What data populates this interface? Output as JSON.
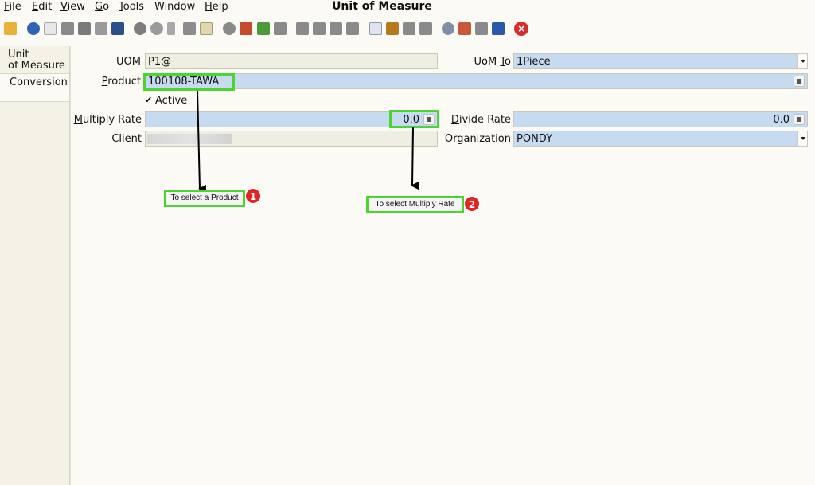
{
  "window_title": "Unit of Measure",
  "menu": [
    {
      "mnemonic": "F",
      "rest": "ile"
    },
    {
      "mnemonic": "E",
      "rest": "dit"
    },
    {
      "mnemonic": "V",
      "rest": "iew"
    },
    {
      "mnemonic": "G",
      "rest": "o"
    },
    {
      "mnemonic": "T",
      "rest": "ools"
    },
    {
      "mnemonic": "",
      "rest": "Window"
    },
    {
      "mnemonic": "H",
      "rest": "elp"
    }
  ],
  "toolbar_icons": [
    "undo-icon",
    "help-icon",
    "new-record-icon",
    "copy-record-icon",
    "delete-icon",
    "delete-selection-icon",
    "save-icon",
    "refresh-icon",
    "find-icon",
    "attachment-icon",
    "chat-icon",
    "grid-toggle-icon",
    "history-icon",
    "home-icon",
    "back-icon",
    "forward-icon",
    "first-record-icon",
    "previous-record-icon",
    "next-record-icon",
    "last-record-icon",
    "report-icon",
    "archive-icon",
    "print-preview-icon",
    "print-icon",
    "zoom-across-icon",
    "workflow-icon",
    "request-icon",
    "product-info-icon",
    "close-window-icon"
  ],
  "tabs": {
    "uom_line1": "Unit",
    "uom_line2": "of Measure",
    "conversion": "Conversion"
  },
  "form": {
    "uom_label": "UOM",
    "uom_value": "P1@",
    "uom_to_label_pre": "UoM ",
    "uom_to_label_mn": "T",
    "uom_to_label_post": "o",
    "uom_to_value": "1Piece",
    "product_label_mn": "P",
    "product_label_rest": "roduct",
    "product_value": "100108-TAWA",
    "active_label": "Active",
    "active_checked": true,
    "multiply_label_mn": "M",
    "multiply_label_rest": "ultiply Rate",
    "multiply_value": "0.0",
    "divide_label_mn": "D",
    "divide_label_rest": "ivide Rate",
    "divide_value": "0.0",
    "client_label": "Client",
    "organization_label": "Organization",
    "organization_value": "PONDY"
  },
  "annotations": {
    "callout1": "To select a Product",
    "badge1": "1",
    "callout2": "To select Multiply Rate",
    "badge2": "2"
  },
  "colors": {
    "editable_field": "#c6daf0",
    "readonly_field": "#efeee2",
    "highlight": "#4cd433",
    "badge": "#e22424"
  }
}
